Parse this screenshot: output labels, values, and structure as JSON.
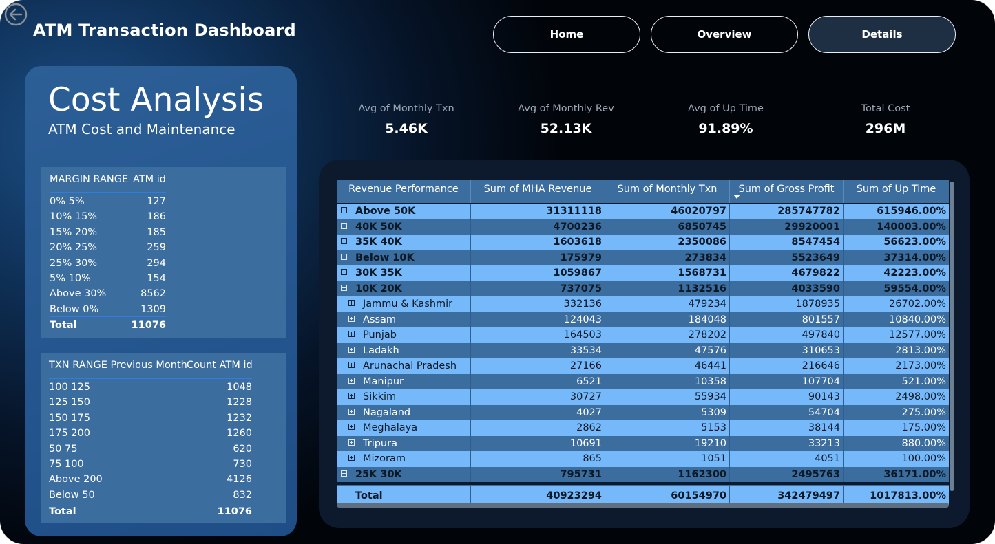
{
  "header": {
    "title": "ATM Transaction Dashboard",
    "nav": [
      {
        "label": "Home"
      },
      {
        "label": "Overview"
      },
      {
        "label": "Details"
      }
    ]
  },
  "left_panel": {
    "title": "Cost Analysis",
    "subtitle": "ATM Cost and Maintenance",
    "margin_table": {
      "col1": "MARGIN RANGE",
      "col2": "ATM id",
      "rows": [
        {
          "range": "0% 5%",
          "count": "127"
        },
        {
          "range": "10% 15%",
          "count": "186"
        },
        {
          "range": "15% 20%",
          "count": "185"
        },
        {
          "range": "20% 25%",
          "count": "259"
        },
        {
          "range": "25% 30%",
          "count": "294"
        },
        {
          "range": "5% 10%",
          "count": "154"
        },
        {
          "range": "Above 30%",
          "count": "8562"
        },
        {
          "range": "Below 0%",
          "count": "1309"
        }
      ],
      "total_label": "Total",
      "total_value": "11076"
    },
    "txn_table": {
      "col1": "TXN RANGE Previous Month",
      "col2": "Count ATM id",
      "rows": [
        {
          "range": "100 125",
          "count": "1048"
        },
        {
          "range": "125 150",
          "count": "1228"
        },
        {
          "range": "150 175",
          "count": "1232"
        },
        {
          "range": "175 200",
          "count": "1260"
        },
        {
          "range": "50 75",
          "count": "620"
        },
        {
          "range": "75 100",
          "count": "730"
        },
        {
          "range": "Above 200",
          "count": "4126"
        },
        {
          "range": "Below 50",
          "count": "832"
        }
      ],
      "total_label": "Total",
      "total_value": "11076"
    }
  },
  "kpis": [
    {
      "label": "Avg of Monthly Txn",
      "value": "5.46K"
    },
    {
      "label": "Avg of Monthly Rev",
      "value": "52.13K"
    },
    {
      "label": "Avg of Up Time",
      "value": "91.89%"
    },
    {
      "label": "Total Cost",
      "value": "296M"
    }
  ],
  "matrix": {
    "columns": [
      "Revenue Performance",
      "Sum of MHA Revenue",
      "Sum of Monthly Txn",
      "Sum of Gross Profit",
      "Sum of Up Time"
    ],
    "sorted_column": "Sum of Gross Profit",
    "rows": [
      {
        "label": "Above 50K",
        "level": 0,
        "expanded": false,
        "mha": "31311118",
        "txn": "46020797",
        "profit": "285747782",
        "uptime": "615946.00%"
      },
      {
        "label": "40K 50K",
        "level": 0,
        "expanded": false,
        "mha": "4700236",
        "txn": "6850745",
        "profit": "29920001",
        "uptime": "140003.00%"
      },
      {
        "label": "35K 40K",
        "level": 0,
        "expanded": false,
        "mha": "1603618",
        "txn": "2350086",
        "profit": "8547454",
        "uptime": "56623.00%"
      },
      {
        "label": "Below 10K",
        "level": 0,
        "expanded": false,
        "mha": "175979",
        "txn": "273834",
        "profit": "5523649",
        "uptime": "37314.00%"
      },
      {
        "label": "30K 35K",
        "level": 0,
        "expanded": false,
        "mha": "1059867",
        "txn": "1568731",
        "profit": "4679822",
        "uptime": "42223.00%"
      },
      {
        "label": "10K 20K",
        "level": 0,
        "expanded": true,
        "mha": "737075",
        "txn": "1132516",
        "profit": "4033590",
        "uptime": "59554.00%"
      },
      {
        "label": "Jammu & Kashmir",
        "level": 1,
        "expanded": false,
        "mha": "332136",
        "txn": "479234",
        "profit": "1878935",
        "uptime": "26702.00%"
      },
      {
        "label": "Assam",
        "level": 1,
        "expanded": false,
        "mha": "124043",
        "txn": "184048",
        "profit": "801557",
        "uptime": "10840.00%"
      },
      {
        "label": "Punjab",
        "level": 1,
        "expanded": false,
        "mha": "164503",
        "txn": "278202",
        "profit": "497840",
        "uptime": "12577.00%"
      },
      {
        "label": "Ladakh",
        "level": 1,
        "expanded": false,
        "mha": "33534",
        "txn": "47576",
        "profit": "310653",
        "uptime": "2813.00%"
      },
      {
        "label": "Arunachal Pradesh",
        "level": 1,
        "expanded": false,
        "mha": "27166",
        "txn": "46441",
        "profit": "216646",
        "uptime": "2173.00%"
      },
      {
        "label": "Manipur",
        "level": 1,
        "expanded": false,
        "mha": "6521",
        "txn": "10358",
        "profit": "107704",
        "uptime": "521.00%"
      },
      {
        "label": "Sikkim",
        "level": 1,
        "expanded": false,
        "mha": "30727",
        "txn": "55934",
        "profit": "90143",
        "uptime": "2498.00%"
      },
      {
        "label": "Nagaland",
        "level": 1,
        "expanded": false,
        "mha": "4027",
        "txn": "5309",
        "profit": "54704",
        "uptime": "275.00%"
      },
      {
        "label": "Meghalaya",
        "level": 1,
        "expanded": false,
        "mha": "2862",
        "txn": "5153",
        "profit": "38144",
        "uptime": "175.00%"
      },
      {
        "label": "Tripura",
        "level": 1,
        "expanded": false,
        "mha": "10691",
        "txn": "19210",
        "profit": "33213",
        "uptime": "880.00%"
      },
      {
        "label": "Mizoram",
        "level": 1,
        "expanded": false,
        "mha": "865",
        "txn": "1051",
        "profit": "4051",
        "uptime": "100.00%"
      },
      {
        "label": "25K 30K",
        "level": 0,
        "expanded": false,
        "mha": "795731",
        "txn": "1162300",
        "profit": "2495763",
        "uptime": "36171.00%"
      }
    ],
    "total": {
      "label": "Total",
      "mha": "40923294",
      "txn": "60154970",
      "profit": "342479497",
      "uptime": "1017813.00%"
    }
  },
  "colors": {
    "row_light": "#76b9fb",
    "row_dark": "#3c6d9f",
    "panel": "#2d5f97",
    "background": "#010409"
  }
}
